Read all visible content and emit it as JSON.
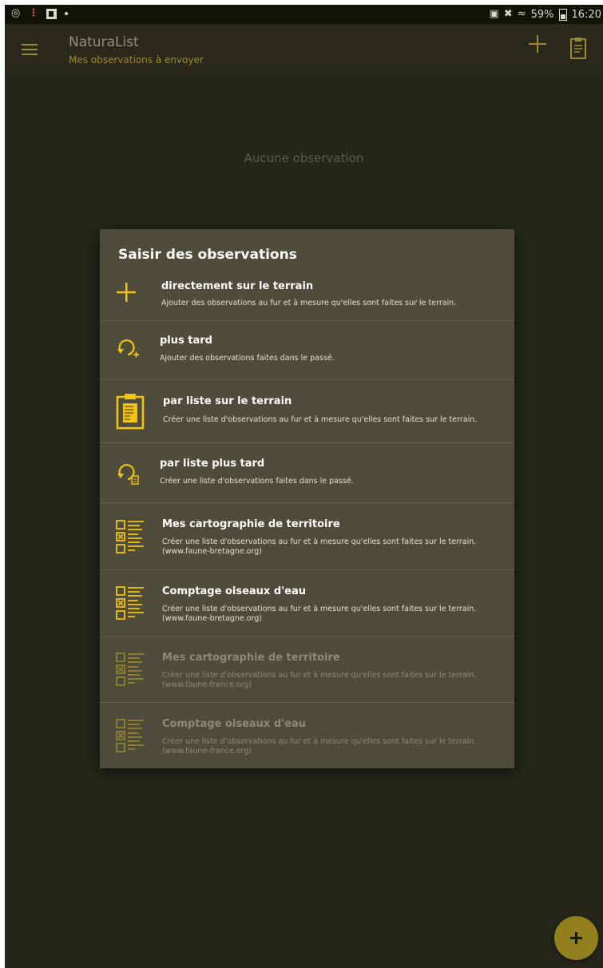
{
  "status_bar": {
    "right_text": "59%",
    "time": "16:20"
  },
  "app_bar": {
    "title": "NaturaList",
    "subtitle": "Mes observations à envoyer"
  },
  "main": {
    "empty_text": "Aucune observation"
  },
  "dialog": {
    "title": "Saisir des observations",
    "items": [
      {
        "icon": "plus-icon",
        "title": "directement sur le terrain",
        "desc": "Ajouter des observations au fur et à mesure qu'elles sont faites sur le terrain.",
        "desc2": "",
        "enabled": true
      },
      {
        "icon": "history-plus-icon",
        "title": "plus tard",
        "desc": "Ajouter des observations faites dans le passé.",
        "desc2": "",
        "enabled": true
      },
      {
        "icon": "clipboard-list-icon",
        "title": "par liste sur le terrain",
        "desc": "Créer une liste d'observations au fur et à mesure qu'elles sont faites sur le terrain.",
        "desc2": "",
        "enabled": true
      },
      {
        "icon": "history-list-icon",
        "title": "par liste plus tard",
        "desc": "Créer une liste d'observations faites dans le passé.",
        "desc2": "",
        "enabled": true
      },
      {
        "icon": "checklist-icon",
        "title": "Mes cartographie de territoire",
        "desc": "Créer une liste d'observations au fur et à mesure qu'elles sont faites sur le terrain.",
        "desc2": "(www.faune-bretagne.org)",
        "enabled": true
      },
      {
        "icon": "checklist-icon",
        "title": "Comptage oiseaux d'eau",
        "desc": "Créer une liste d'observations au fur et à mesure qu'elles sont faites sur le terrain.",
        "desc2": "(www.faune-bretagne.org)",
        "enabled": true
      },
      {
        "icon": "checklist-icon",
        "title": "Mes cartographie de territoire",
        "desc": "Créer une liste d'observations au fur et à mesure qu'elles sont faites sur le terrain.",
        "desc2": "(www.faune-france.org)",
        "enabled": false
      },
      {
        "icon": "checklist-icon",
        "title": "Comptage oiseaux d'eau",
        "desc": "Créer une liste d'observations au fur et à mesure qu'elles sont faites sur le terrain.",
        "desc2": "(www.faune-france.org)",
        "enabled": false
      }
    ]
  },
  "colors": {
    "accent": "#f2c40e",
    "accent_dim": "#9b8a34",
    "background": "#27261a",
    "dialog": "#4f4c3b"
  }
}
